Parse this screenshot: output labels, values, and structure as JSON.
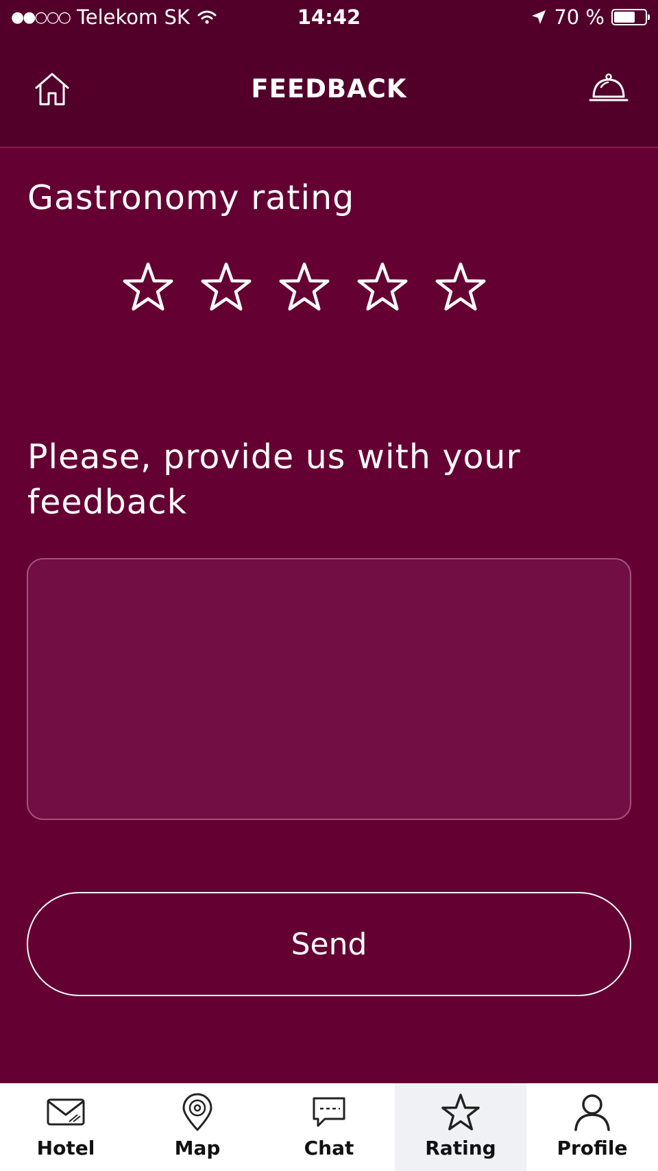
{
  "status_bar": {
    "signal": "●●○○○",
    "carrier": "Telekom SK",
    "time": "14:42",
    "battery_text": "70 %",
    "battery_level": 0.7
  },
  "nav": {
    "title": "FEEDBACK",
    "left_icon": "home-icon",
    "right_icon": "concierge-bell-icon"
  },
  "rating": {
    "heading": "Gastronomy rating",
    "max_stars": 5,
    "selected": 0
  },
  "feedback": {
    "heading": "Please, provide us with your feedback",
    "value": "",
    "placeholder": ""
  },
  "send_label": "Send",
  "tabs": [
    {
      "label": "Hotel",
      "icon": "envelope-icon",
      "active": false
    },
    {
      "label": "Map",
      "icon": "map-pin-icon",
      "active": false
    },
    {
      "label": "Chat",
      "icon": "chat-bubble-icon",
      "active": false
    },
    {
      "label": "Rating",
      "icon": "star-icon",
      "active": true
    },
    {
      "label": "Profile",
      "icon": "person-icon",
      "active": false
    }
  ],
  "colors": {
    "background": "#650033",
    "header": "#520029",
    "textarea_fill": "#720e43",
    "tab_bar": "#ffffff",
    "tab_active": "#eff1f4"
  }
}
